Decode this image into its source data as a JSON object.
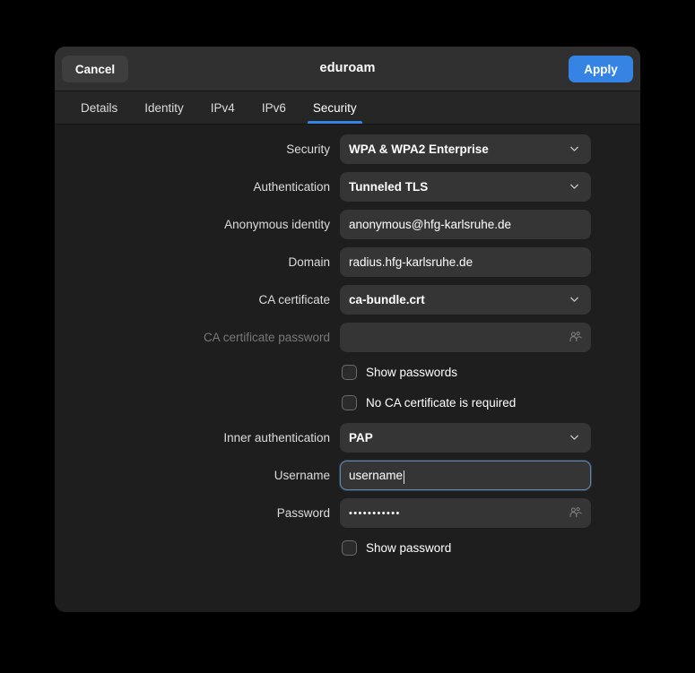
{
  "dialog": {
    "title": "eduroam",
    "cancel_label": "Cancel",
    "apply_label": "Apply",
    "accent_color": "#3584e4",
    "header_bg": "#303030",
    "body_bg": "#1e1e1e",
    "field_bg": "#353535",
    "focus_border_color": "#5e87b0"
  },
  "tabs": [
    {
      "label": "Details",
      "active": false
    },
    {
      "label": "Identity",
      "active": false
    },
    {
      "label": "IPv4",
      "active": false
    },
    {
      "label": "IPv6",
      "active": false
    },
    {
      "label": "Security",
      "active": true
    }
  ],
  "form": {
    "security": {
      "label": "Security",
      "value": "WPA & WPA2 Enterprise",
      "type": "dropdown"
    },
    "authentication": {
      "label": "Authentication",
      "value": "Tunneled TLS",
      "type": "dropdown"
    },
    "anonymous_identity": {
      "label": "Anonymous identity",
      "value": "anonymous@hfg-karlsruhe.de",
      "placeholder": "",
      "type": "text"
    },
    "domain": {
      "label": "Domain",
      "value": "radius.hfg-karlsruhe.de",
      "placeholder": "",
      "type": "text"
    },
    "ca_certificate": {
      "label": "CA certificate",
      "value": "ca-bundle.crt",
      "type": "dropdown"
    },
    "ca_certificate_password": {
      "label": "CA certificate password",
      "value": "",
      "placeholder": "",
      "type": "password",
      "disabled": true,
      "peek_icon": "password-peek-icon"
    },
    "show_passwords": {
      "label": "Show passwords",
      "checked": false
    },
    "no_ca_certificate_required": {
      "label": "No CA certificate is required",
      "checked": false
    },
    "inner_authentication": {
      "label": "Inner authentication",
      "value": "PAP",
      "type": "dropdown"
    },
    "username": {
      "label": "Username",
      "value": "username",
      "placeholder": "",
      "type": "text",
      "focused": true
    },
    "password": {
      "label": "Password",
      "value": "•••••••••••",
      "placeholder": "",
      "type": "password",
      "peek_icon": "password-peek-icon"
    },
    "show_password": {
      "label": "Show password",
      "checked": false
    }
  }
}
